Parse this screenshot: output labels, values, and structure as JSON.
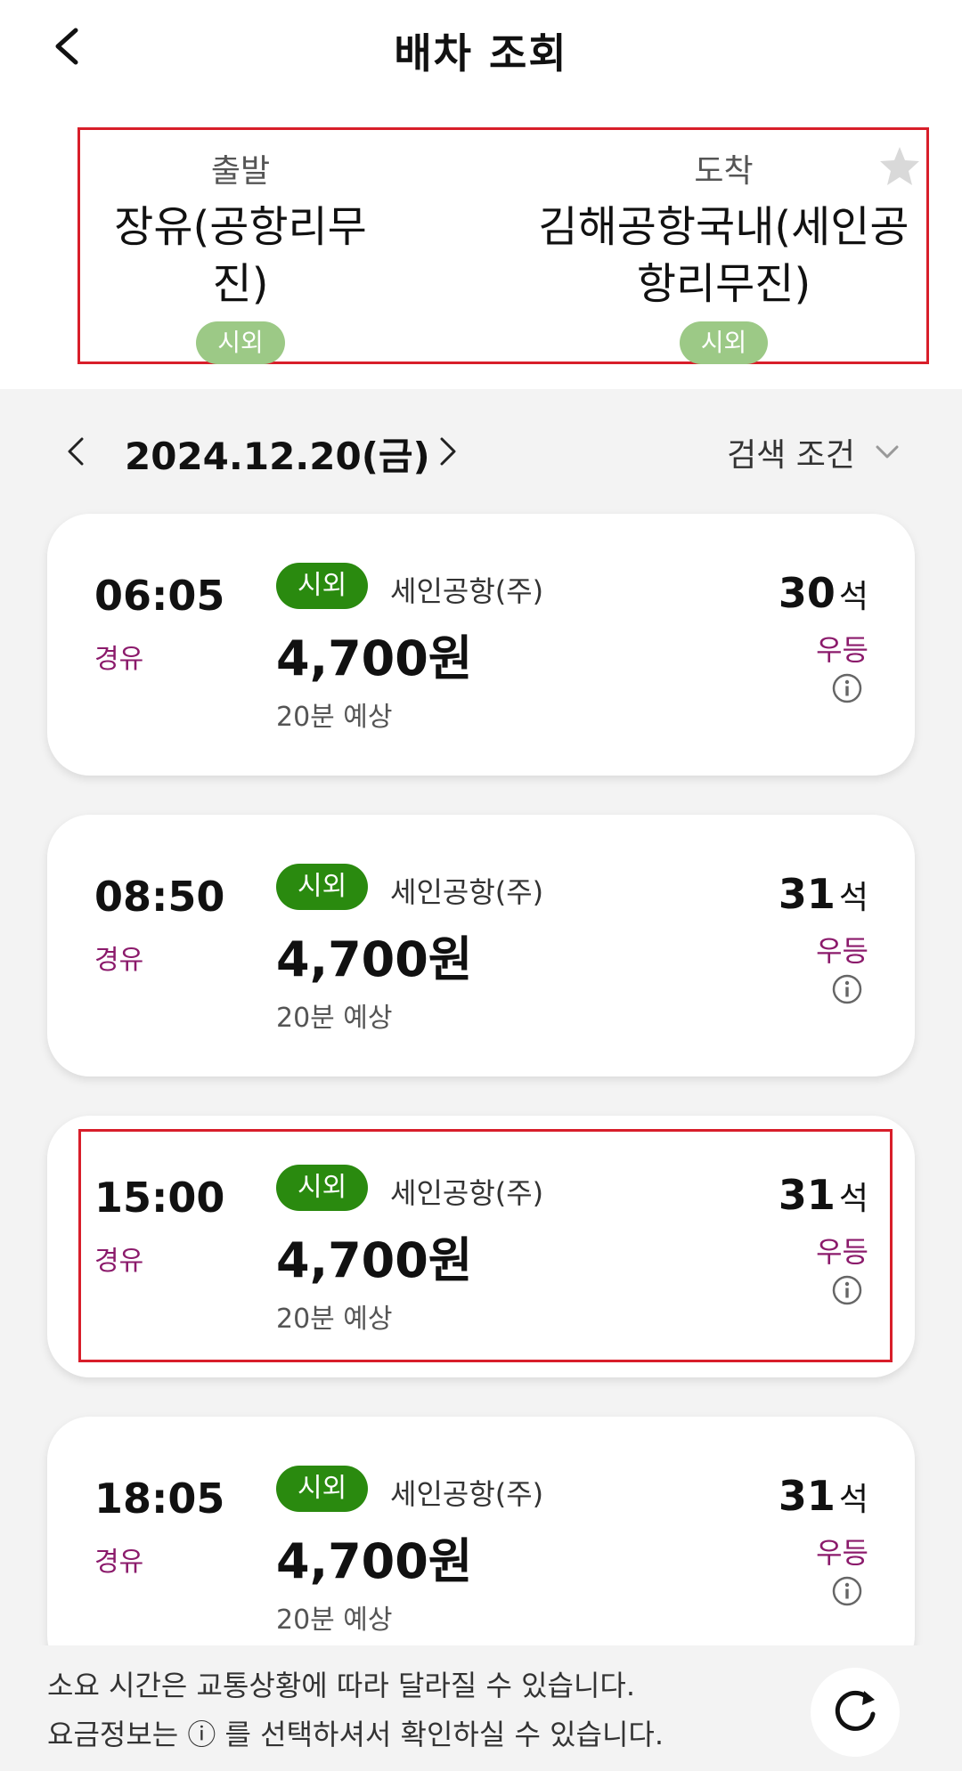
{
  "header": {
    "title": "배차 조회"
  },
  "route": {
    "depart_label": "출발",
    "depart_name": "장유(공항리무진)",
    "depart_badge": "시외",
    "arrive_label": "도착",
    "arrive_name": "김해공항국내(세인공항리무진)",
    "arrive_badge": "시외"
  },
  "datebar": {
    "date": "2024.12.20(금)",
    "search_label": "검색 조건"
  },
  "schedules": [
    {
      "time": "06:05",
      "via": "경유",
      "badge": "시외",
      "company": "세인공항(주)",
      "price": "4,700원",
      "duration": "20분 예상",
      "seats": "30",
      "seat_unit": "석",
      "grade": "우등"
    },
    {
      "time": "08:50",
      "via": "경유",
      "badge": "시외",
      "company": "세인공항(주)",
      "price": "4,700원",
      "duration": "20분 예상",
      "seats": "31",
      "seat_unit": "석",
      "grade": "우등"
    },
    {
      "time": "15:00",
      "via": "경유",
      "badge": "시외",
      "company": "세인공항(주)",
      "price": "4,700원",
      "duration": "20분 예상",
      "seats": "31",
      "seat_unit": "석",
      "grade": "우등"
    },
    {
      "time": "18:05",
      "via": "경유",
      "badge": "시외",
      "company": "세인공항(주)",
      "price": "4,700원",
      "duration": "20분 예상",
      "seats": "31",
      "seat_unit": "석",
      "grade": "우등"
    }
  ],
  "footer": {
    "line1": "소요 시간은 교통상황에 따라 달라질 수 있습니다.",
    "line2": "요금정보는 ⓘ 를 선택하셔서 확인하실 수 있습니다."
  },
  "colors": {
    "accent_dark": "#2a8a0f",
    "accent_light": "#9cc986",
    "purple": "#8b1a6b",
    "highlight": "#d81e2a"
  }
}
